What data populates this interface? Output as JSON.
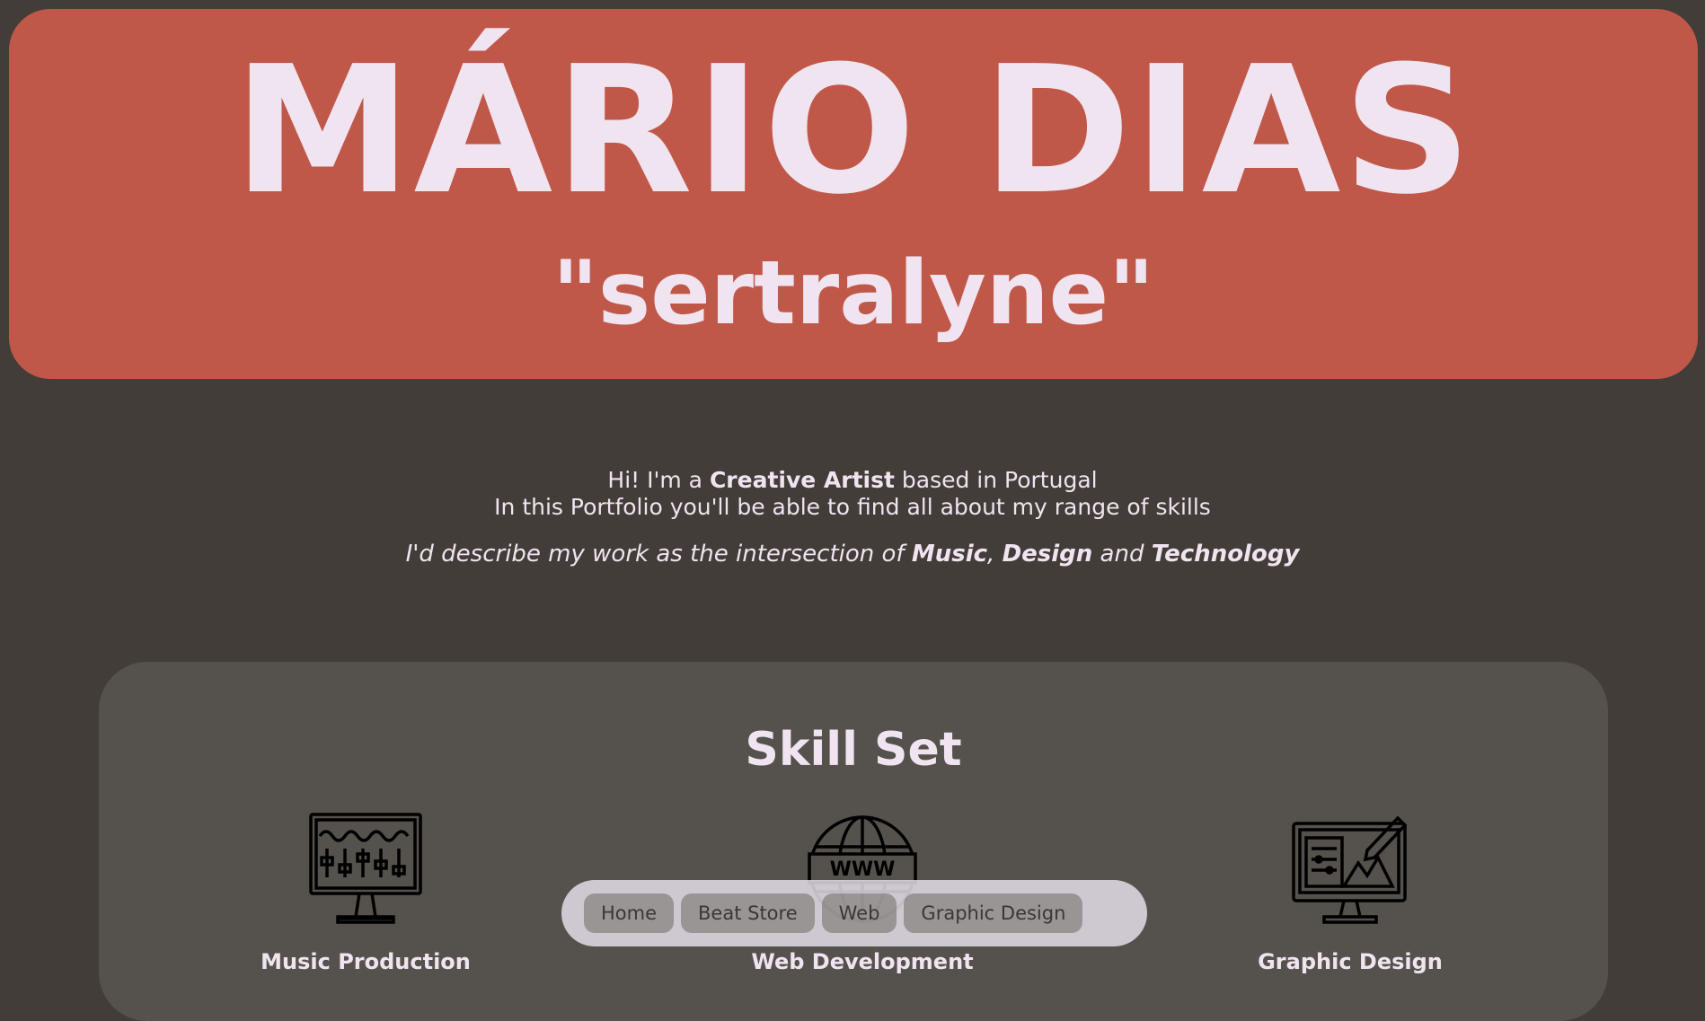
{
  "hero": {
    "name": "MÁRIO DIAS",
    "alias": "\"sertralyne\""
  },
  "intro": {
    "line1_pre": "Hi! I'm a ",
    "line1_bold": "Creative Artist",
    "line1_post": " based in Portugal",
    "line2": "In this Portfolio you'll be able to find all about my range of skills",
    "tagline_pre": "I'd describe my work as the intersection of ",
    "tagline_music": "Music",
    "tagline_sep": ", ",
    "tagline_design": "Design",
    "tagline_and": " and ",
    "tagline_tech": "Technology"
  },
  "skills": {
    "title": "Skill Set",
    "items": [
      {
        "label": "Music Production",
        "icon": "mixer-monitor-icon"
      },
      {
        "label": "Web Development",
        "icon": "globe-www-icon"
      },
      {
        "label": "Graphic Design",
        "icon": "design-monitor-icon"
      }
    ]
  },
  "nav": {
    "items": [
      "Home",
      "Beat Store",
      "Web",
      "Graphic Design"
    ]
  },
  "colors": {
    "background": "#423d38",
    "hero": "#c05849",
    "text": "#f1e4f1",
    "panel": "#55524d"
  }
}
